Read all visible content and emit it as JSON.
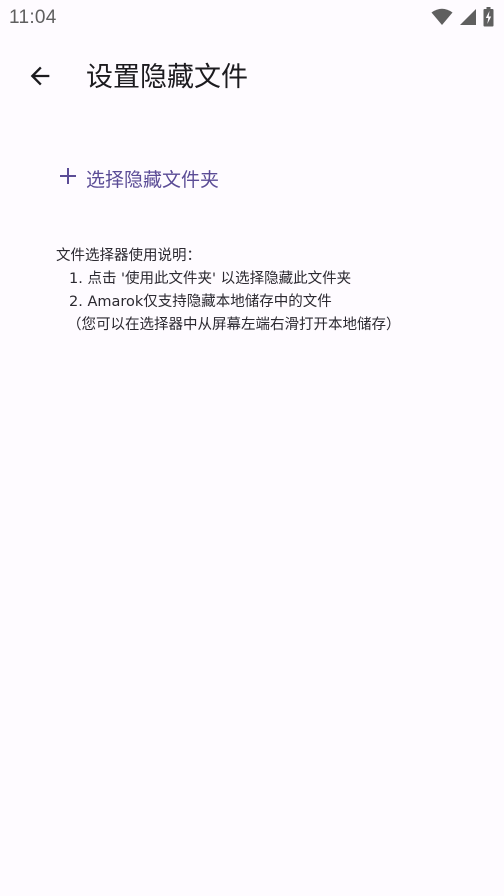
{
  "status_bar": {
    "time": "11:04",
    "icons": [
      "wifi-icon",
      "signal-icon",
      "battery-charging-icon"
    ]
  },
  "app_bar": {
    "back_icon": "arrow-back-icon",
    "title": "设置隐藏文件"
  },
  "select_folder": {
    "icon": "plus-icon",
    "label": "选择隐藏文件夹"
  },
  "instructions": {
    "heading": "文件选择器使用说明：",
    "items": [
      "1. 点击 '使用此文件夹' 以选择隐藏此文件夹",
      "2. Amarok仅支持隐藏本地储存中的文件"
    ],
    "note": "（您可以在选择器中从屏幕左端右滑打开本地储存）"
  },
  "colors": {
    "background": "#fefbff",
    "accent": "#5b4c96",
    "text": "#1c1b1f",
    "status_icon": "#5f5f5f"
  }
}
